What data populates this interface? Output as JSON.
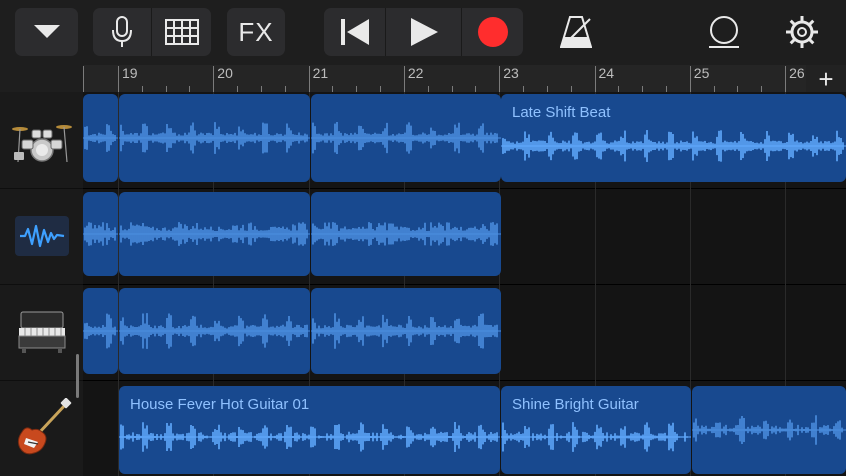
{
  "toolbar": {
    "buttons": [
      {
        "name": "menu-dropdown-button",
        "icon": "chevron-down-icon"
      },
      {
        "name": "mic-button",
        "icon": "microphone-icon"
      },
      {
        "name": "grid-button",
        "icon": "grid-icon"
      },
      {
        "name": "fx-button",
        "label": "FX"
      },
      {
        "name": "rewind-button",
        "icon": "skip-back-icon"
      },
      {
        "name": "play-button",
        "icon": "play-icon"
      },
      {
        "name": "record-button",
        "icon": "record-icon"
      },
      {
        "name": "metronome-button",
        "icon": "metronome-icon"
      },
      {
        "name": "loop-browser-button",
        "icon": "loop-icon"
      },
      {
        "name": "settings-button",
        "icon": "gear-icon"
      }
    ],
    "fx_label": "FX",
    "record_color": "#ff2d2d"
  },
  "ruler": {
    "bars": [
      "19",
      "20",
      "21",
      "22",
      "23",
      "24",
      "25",
      "26"
    ],
    "add_label": "+"
  },
  "tracks": [
    {
      "instrument": "drums-icon"
    },
    {
      "instrument": "audio-waveform-icon"
    },
    {
      "instrument": "keyboard-piano-icon"
    },
    {
      "instrument": "electric-guitar-icon"
    }
  ],
  "regions": [
    {
      "track": 0,
      "title": ""
    },
    {
      "track": 0,
      "title": ""
    },
    {
      "track": 0,
      "title": ""
    },
    {
      "track": 0,
      "title": "Late Shift Beat"
    },
    {
      "track": 1,
      "title": ""
    },
    {
      "track": 1,
      "title": ""
    },
    {
      "track": 1,
      "title": ""
    },
    {
      "track": 2,
      "title": ""
    },
    {
      "track": 2,
      "title": ""
    },
    {
      "track": 2,
      "title": ""
    },
    {
      "track": 3,
      "title": "House Fever Hot Guitar 01"
    },
    {
      "track": 3,
      "title": "Shine Bright Guitar"
    },
    {
      "track": 3,
      "title": ""
    }
  ],
  "colors": {
    "region": "#18498f",
    "waveform_dim": "#4c8fe0",
    "waveform_bright": "#62abff",
    "region_title": "#8fc1ff"
  }
}
